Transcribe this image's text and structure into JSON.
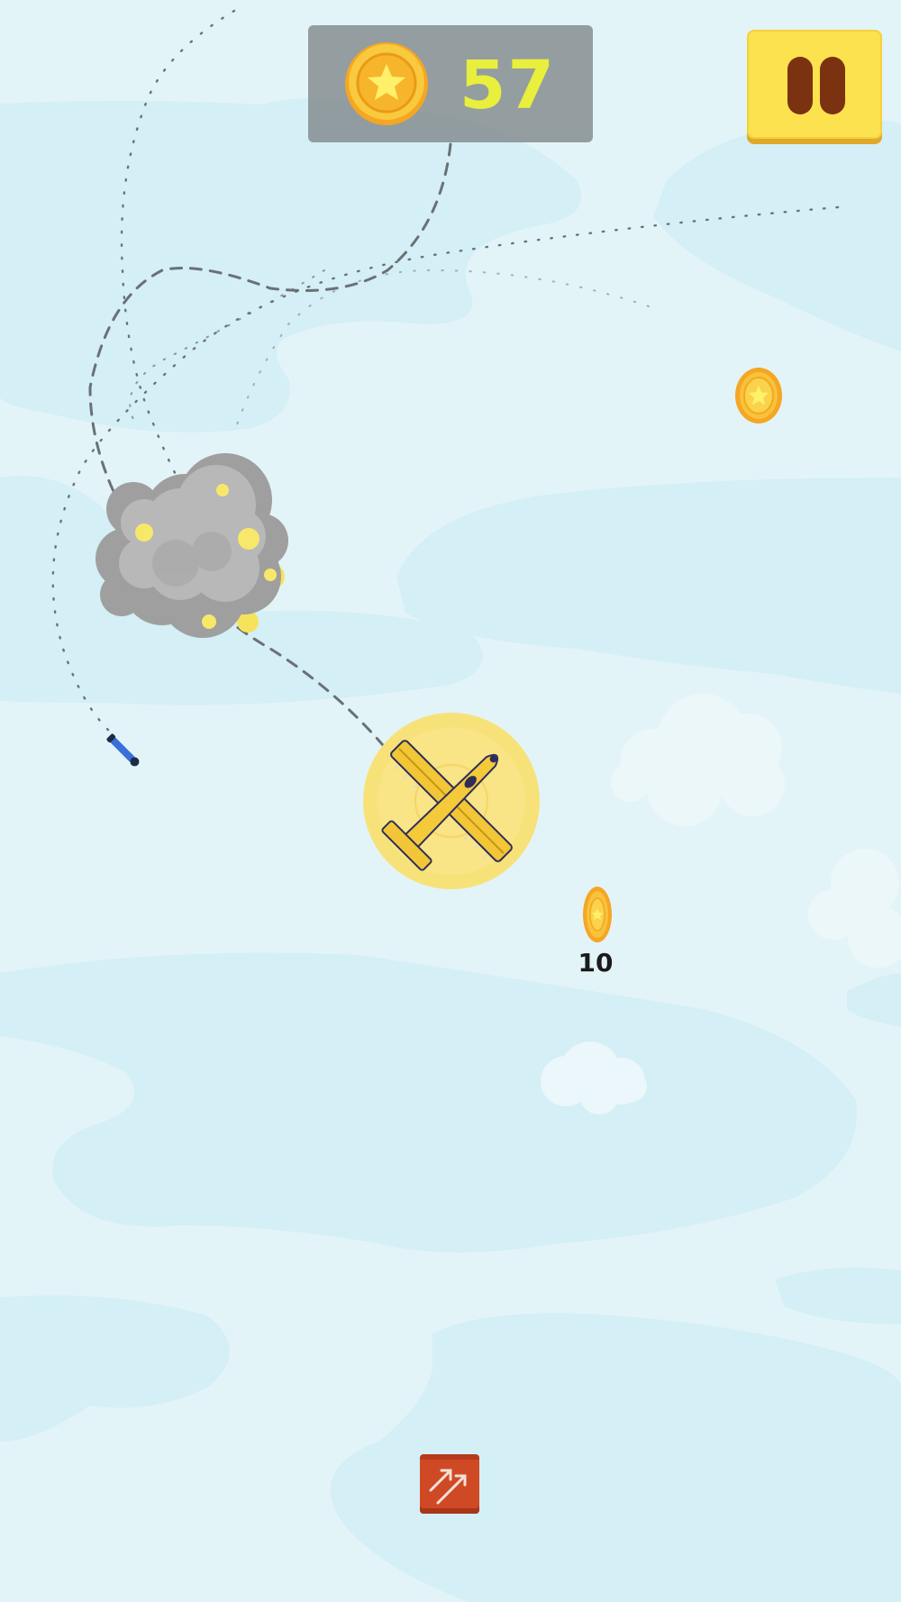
{
  "hud": {
    "coin_count": "57",
    "coin_icon": "star-coin-icon",
    "pause_icon": "pause-icon"
  },
  "pickups": {
    "coin_reward_label": "10"
  },
  "powerup": {
    "icon": "double-arrow-boost-icon"
  },
  "colors": {
    "sky": "#d6f0f6",
    "coin_gold": "#f5b82e",
    "coin_count_text": "#e8ef3c",
    "pause_button": "#fbe24e",
    "plane_yellow": "#f2c636",
    "smoke_gray": "#a4a4a4",
    "crate_orange": "#cf4a24"
  }
}
